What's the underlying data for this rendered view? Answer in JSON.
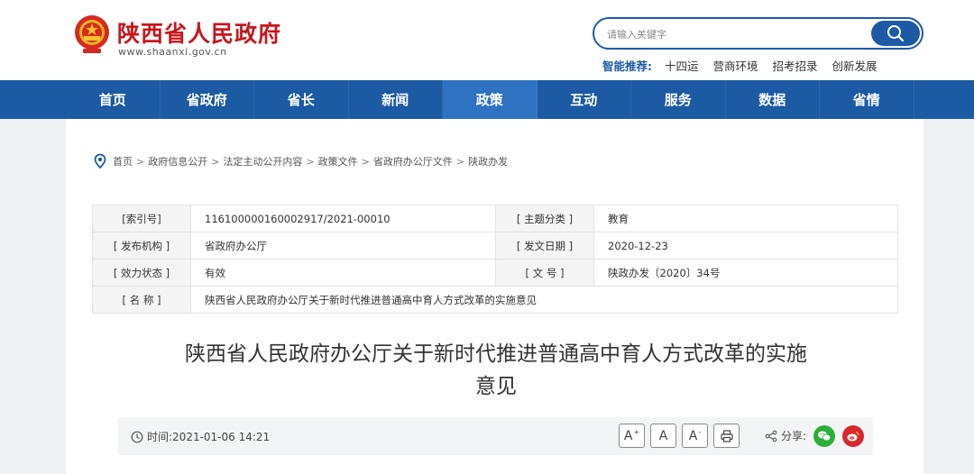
{
  "header": {
    "site_title": "陕西省人民政府",
    "site_url": "www.shaanxi.gov.cn",
    "search_placeholder": "请输入关键字",
    "recommend_label": "智能推荐:",
    "recommend_items": [
      "十四运",
      "营商环境",
      "招考招录",
      "创新发展"
    ]
  },
  "nav": {
    "items": [
      "首页",
      "省政府",
      "省长",
      "新闻",
      "政策",
      "互动",
      "服务",
      "数据",
      "省情"
    ],
    "active": "政策"
  },
  "breadcrumb": [
    "首页",
    "政府信息公开",
    "法定主动公开内容",
    "政策文件",
    "省政府办公厅文件",
    "陕政办发"
  ],
  "breadcrumb_sep": ">",
  "meta": {
    "index_label": "[索引号]",
    "index_value": "116100000160002917/2021-00010",
    "topic_label": "[ 主题分类 ]",
    "topic_value": "教育",
    "issuer_label": "[ 发布机构 ]",
    "issuer_value": "省政府办公厅",
    "date_label": "[ 发文日期 ]",
    "date_value": "2020-12-23",
    "status_label": "[ 效力状态 ]",
    "status_value": "有效",
    "docno_label": "[ 文 号 ]",
    "docno_value": "陕政办发〔2020〕34号",
    "name_label": "[ 名 称 ]",
    "name_value": "陕西省人民政府办公厅关于新时代推进普通高中育人方式改革的实施意见"
  },
  "article": {
    "title_line1": "陕西省人民政府办公厅关于新时代推进普通高中育人方式改革的实施",
    "title_line2": "意见",
    "time_label": "时间:",
    "time_value": "2021-01-06 14:21",
    "font_large": "A",
    "font_large_sup": "+",
    "font_normal": "A",
    "font_small": "A",
    "font_small_sup": "-",
    "share_label": "分享:"
  },
  "colors": {
    "brand_red": "#c8161d",
    "nav_blue": "#1c5aa3",
    "nav_active": "#2f72c2",
    "wechat_green": "#2bae3a",
    "weibo_red": "#d9272e"
  }
}
